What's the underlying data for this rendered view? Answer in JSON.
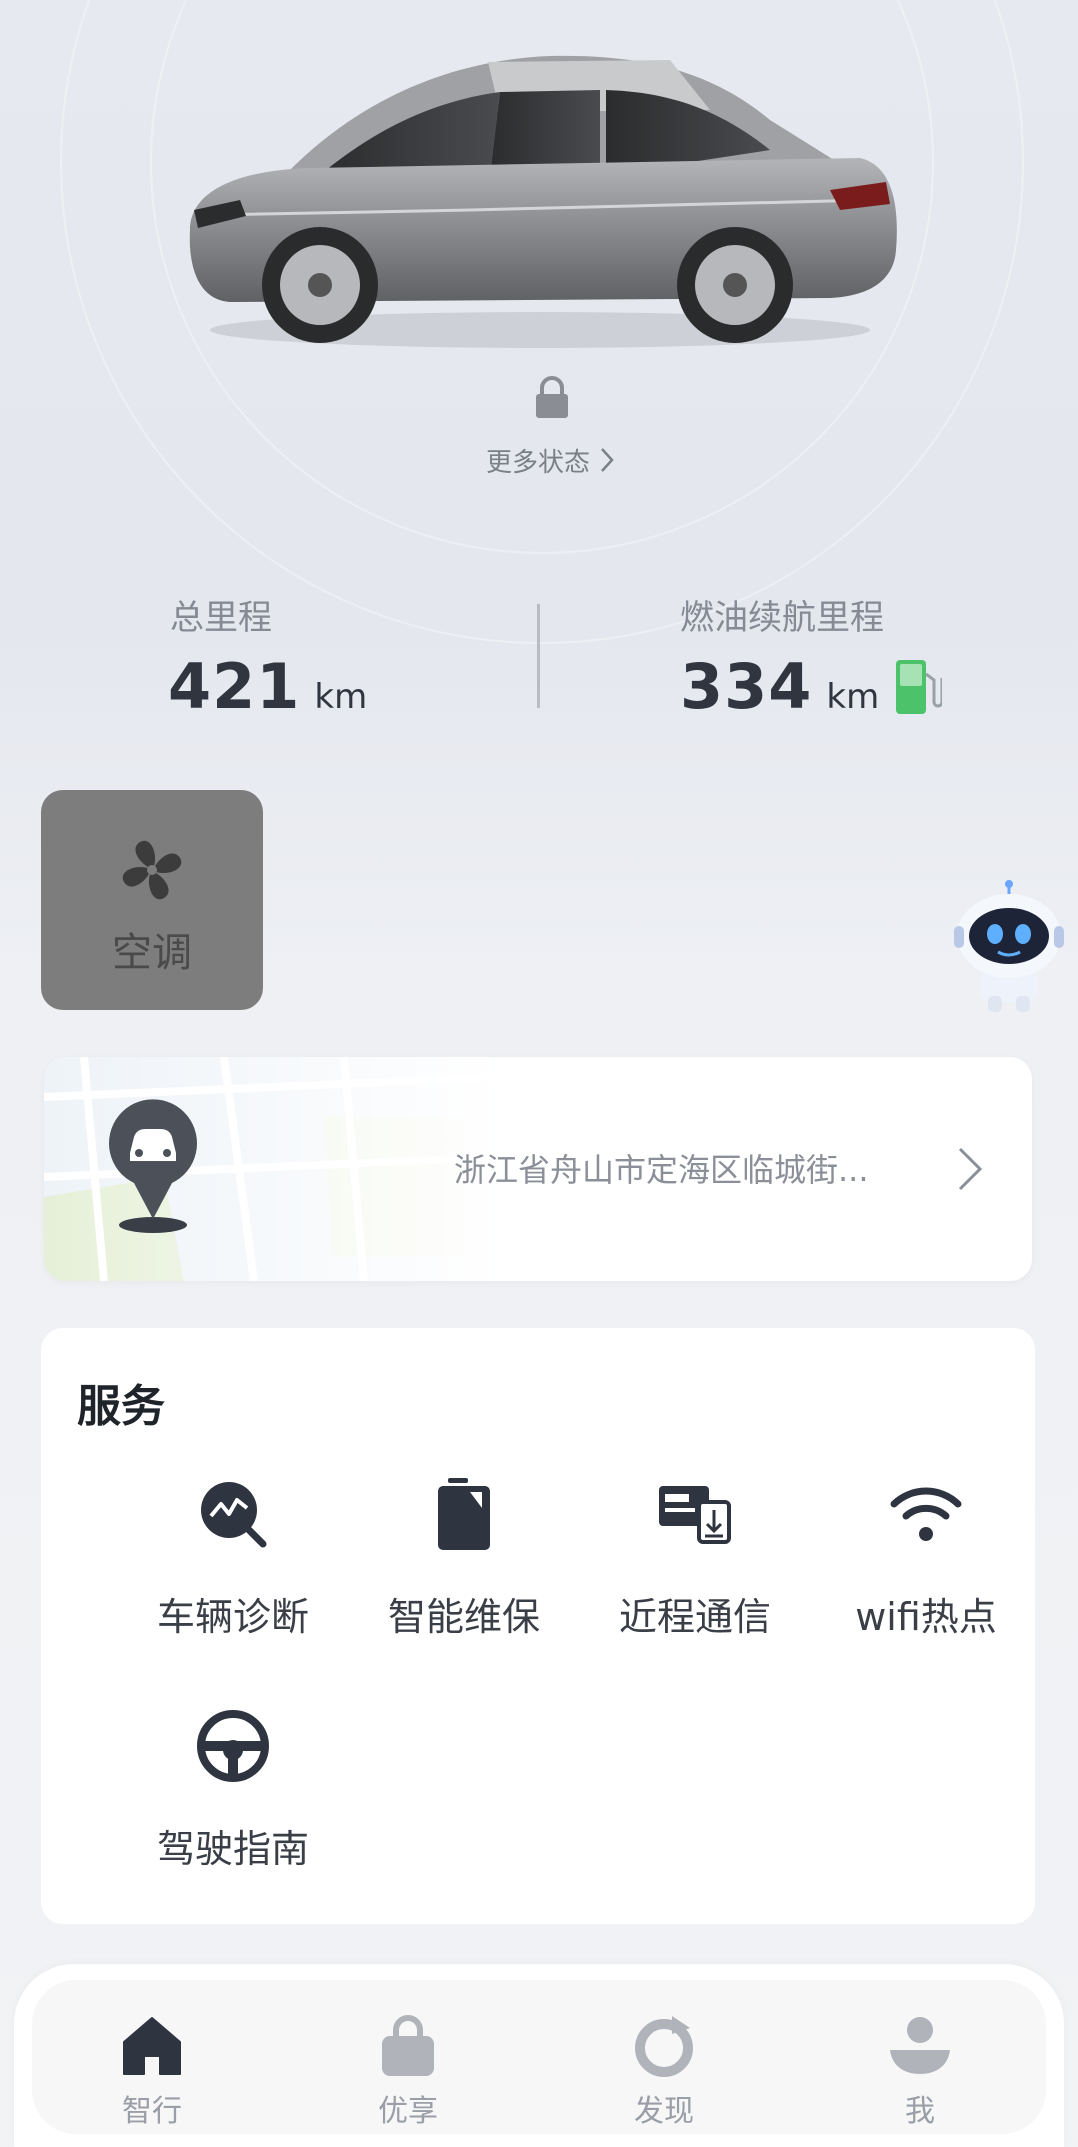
{
  "status": {
    "more_status_label": "更多状态"
  },
  "stats": {
    "total_mileage_label": "总里程",
    "total_mileage_value": "421",
    "total_mileage_unit": "km",
    "fuel_range_label": "燃油续航里程",
    "fuel_range_value": "334",
    "fuel_range_unit": "km"
  },
  "controls": {
    "ac_label": "空调"
  },
  "location": {
    "address": "浙江省舟山市定海区临城街..."
  },
  "services": {
    "title": "服务",
    "items": [
      {
        "label": "车辆诊断",
        "icon": "diagnosis-icon"
      },
      {
        "label": "智能维保",
        "icon": "maintenance-icon"
      },
      {
        "label": "近程通信",
        "icon": "near-communication-icon"
      },
      {
        "label": "wifi热点",
        "icon": "wifi-icon"
      },
      {
        "label": "驾驶指南",
        "icon": "steering-wheel-icon"
      }
    ]
  },
  "tabbar": {
    "items": [
      {
        "label": "智行",
        "icon": "home-icon",
        "active": true
      },
      {
        "label": "优享",
        "icon": "bag-icon",
        "active": false
      },
      {
        "label": "发现",
        "icon": "discover-icon",
        "active": false
      },
      {
        "label": "我",
        "icon": "profile-icon",
        "active": false
      }
    ]
  },
  "colors": {
    "fuel_green": "#4cc36a",
    "ac_tile": "#7d7d7d",
    "dark_icon": "#2f3540"
  }
}
